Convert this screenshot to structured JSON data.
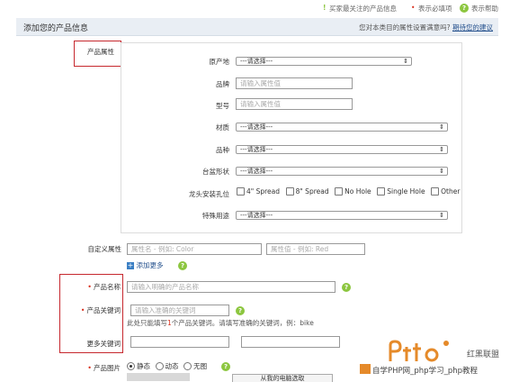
{
  "topbar": {
    "item1": "买家最关注的产品信息",
    "item2": "表示必填项",
    "item3": "表示帮助"
  },
  "header": {
    "title": "添加您的产品信息",
    "question": "您对本类目的属性设置满意吗?",
    "link": "期待您的建议"
  },
  "product_attrs": {
    "section_label": "产品属性",
    "origin_label": "原产地",
    "origin_value": "---请选择---",
    "brand_label": "品牌",
    "brand_placeholder": "请输入属性值",
    "model_label": "型号",
    "model_placeholder": "请输入属性值",
    "material_label": "材质",
    "material_value": "---请选择---",
    "variety_label": "品种",
    "variety_value": "---请选择---",
    "basin_label": "台盆形状",
    "basin_value": "---请选择---",
    "faucet_label": "龙头安装孔位",
    "faucet_options": [
      "4\" Spread",
      "8\" Spread",
      "No Hole",
      "Single Hole",
      "Other"
    ],
    "special_label": "特殊用途",
    "special_value": "---请选择---"
  },
  "custom_attrs": {
    "label": "自定义属性",
    "name_placeholder": "属性名 - 例如: Color",
    "value_placeholder": "属性值 - 例如: Red",
    "add_more": "添加更多"
  },
  "product_name": {
    "label": "产品名称",
    "placeholder": "请输入明确的产品名称"
  },
  "keyword": {
    "label": "产品关键词",
    "placeholder": "请输入准确的关键词",
    "hint_prefix": "此处只能填写",
    "hint_num": "1",
    "hint_suffix": "个产品关键词。请填写准确的关键词，例：bike"
  },
  "more_keywords": {
    "label": "更多关键词"
  },
  "product_image": {
    "label": "产品图片",
    "options": [
      "静态",
      "动态",
      "无图"
    ],
    "bottom_button": "从我的电脑选取"
  },
  "watermark": {
    "brand": "红黑联盟",
    "slogan": "自学PHP网_php学习_php教程"
  },
  "colors": {
    "red_box": "#c6282e",
    "header_bg": "#e9eef4",
    "help_green": "#8cc63f",
    "link_blue": "#24508d"
  }
}
